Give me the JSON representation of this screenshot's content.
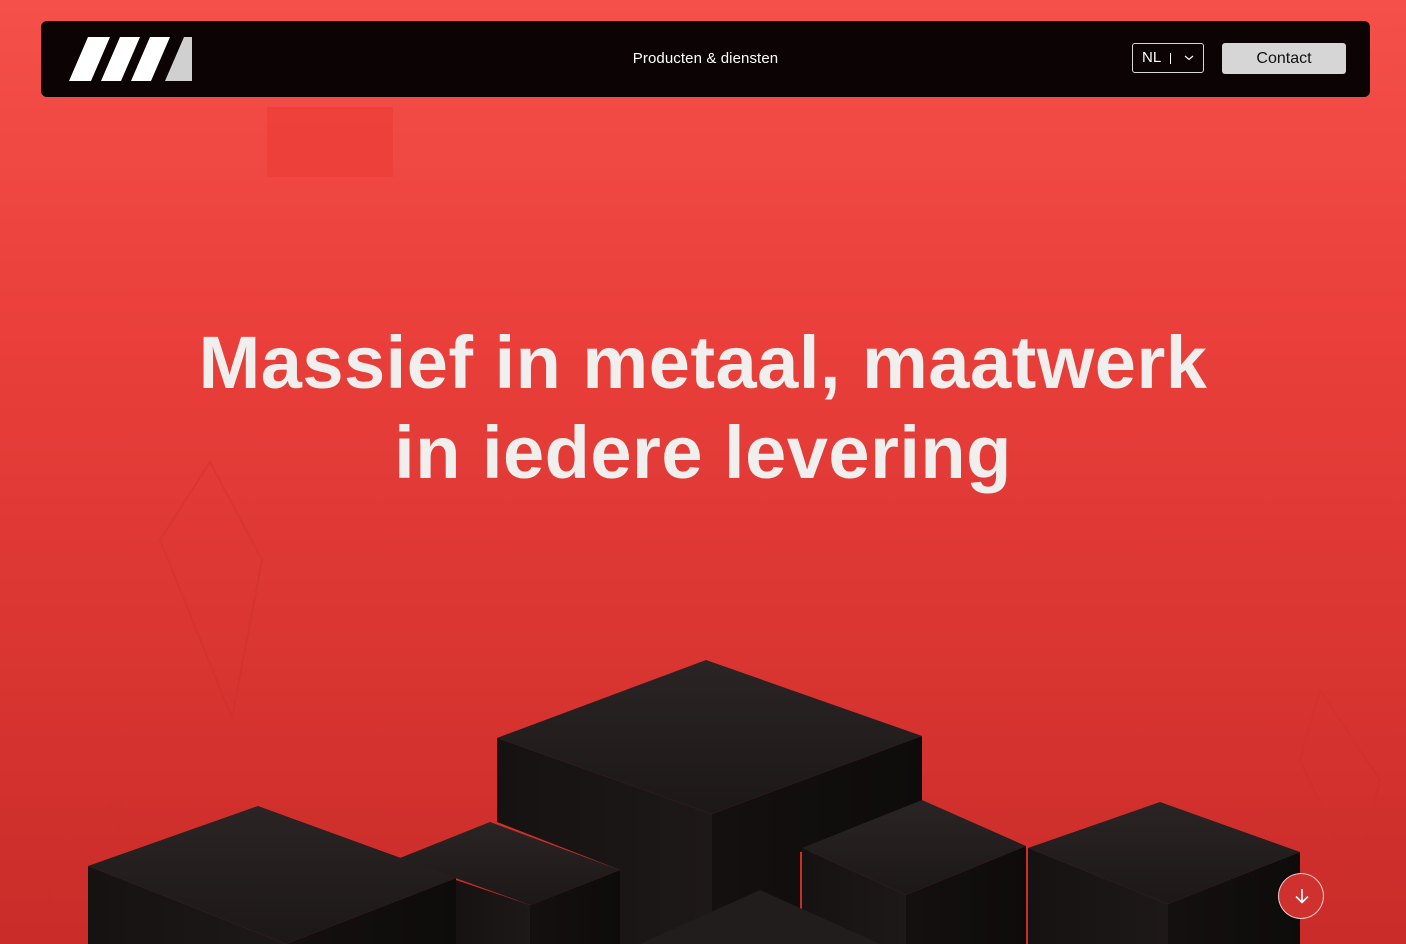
{
  "header": {
    "logo_alt": "Company logo",
    "nav_link": "Producten & diensten",
    "language": {
      "selected": "NL",
      "icon": "chevron-down-icon"
    },
    "contact_label": "Contact"
  },
  "hero": {
    "title_line1": "Massief in metaal, maatwerk",
    "title_line2": "in iedere levering",
    "scroll_icon": "arrow-down-icon"
  },
  "colors": {
    "background_top": "#f5504a",
    "background_bottom": "#c92c29",
    "navbar": "#0b0304",
    "contact_button": "#d6d6d6",
    "title_text": "#f1efed",
    "blocks": "#1a1616"
  }
}
